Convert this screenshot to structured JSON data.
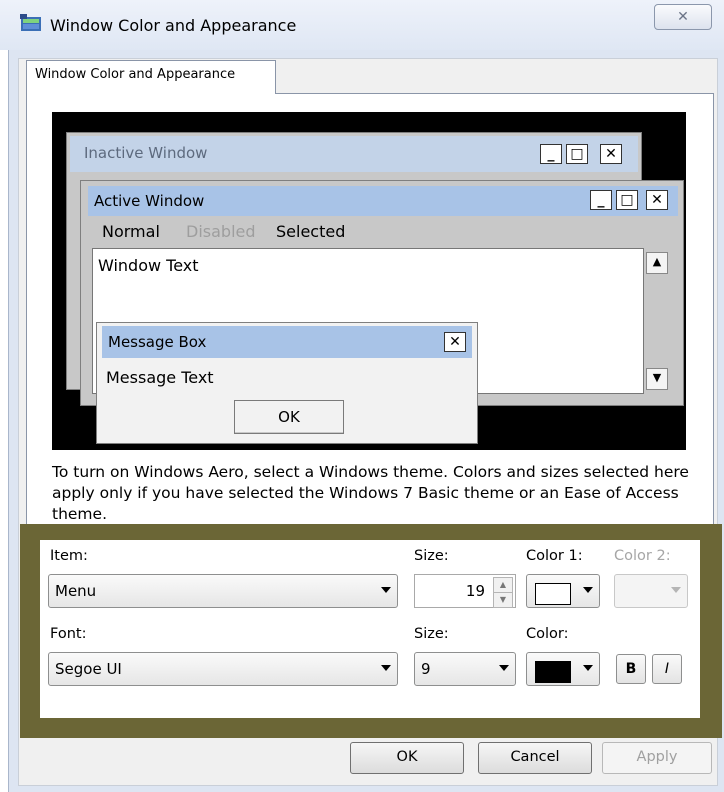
{
  "window": {
    "title": "Window Color and Appearance",
    "close_glyph": "✕"
  },
  "tab": {
    "label": "Window Color and Appearance"
  },
  "preview": {
    "inactive_title": "Inactive Window",
    "active_title": "Active Window",
    "menu_normal": "Normal",
    "menu_disabled": "Disabled",
    "menu_selected": "Selected",
    "window_text": "Window Text",
    "message_box_title": "Message Box",
    "message_text": "Message Text",
    "ok_label": "OK",
    "caption_min": "_",
    "caption_max": "□",
    "caption_close": "✕",
    "scroll_up": "▲",
    "scroll_down": "▼"
  },
  "description": "To turn on Windows Aero, select a Windows theme.  Colors and sizes selected here apply only if you have selected the Windows 7 Basic theme or an Ease of Access theme.",
  "controls": {
    "item_label": "Item:",
    "item_value": "Menu",
    "size_label": "Size:",
    "size_value": "19",
    "color1_label": "Color 1:",
    "color1_value": "#ffffff",
    "color2_label": "Color 2:",
    "font_label": "Font:",
    "font_value": "Segoe UI",
    "font_size_label": "Size:",
    "font_size_value": "9",
    "font_color_label": "Color:",
    "font_color_value": "#000000",
    "bold_label": "B",
    "italic_label": "I"
  },
  "buttons": {
    "ok": "OK",
    "cancel": "Cancel",
    "apply": "Apply"
  }
}
